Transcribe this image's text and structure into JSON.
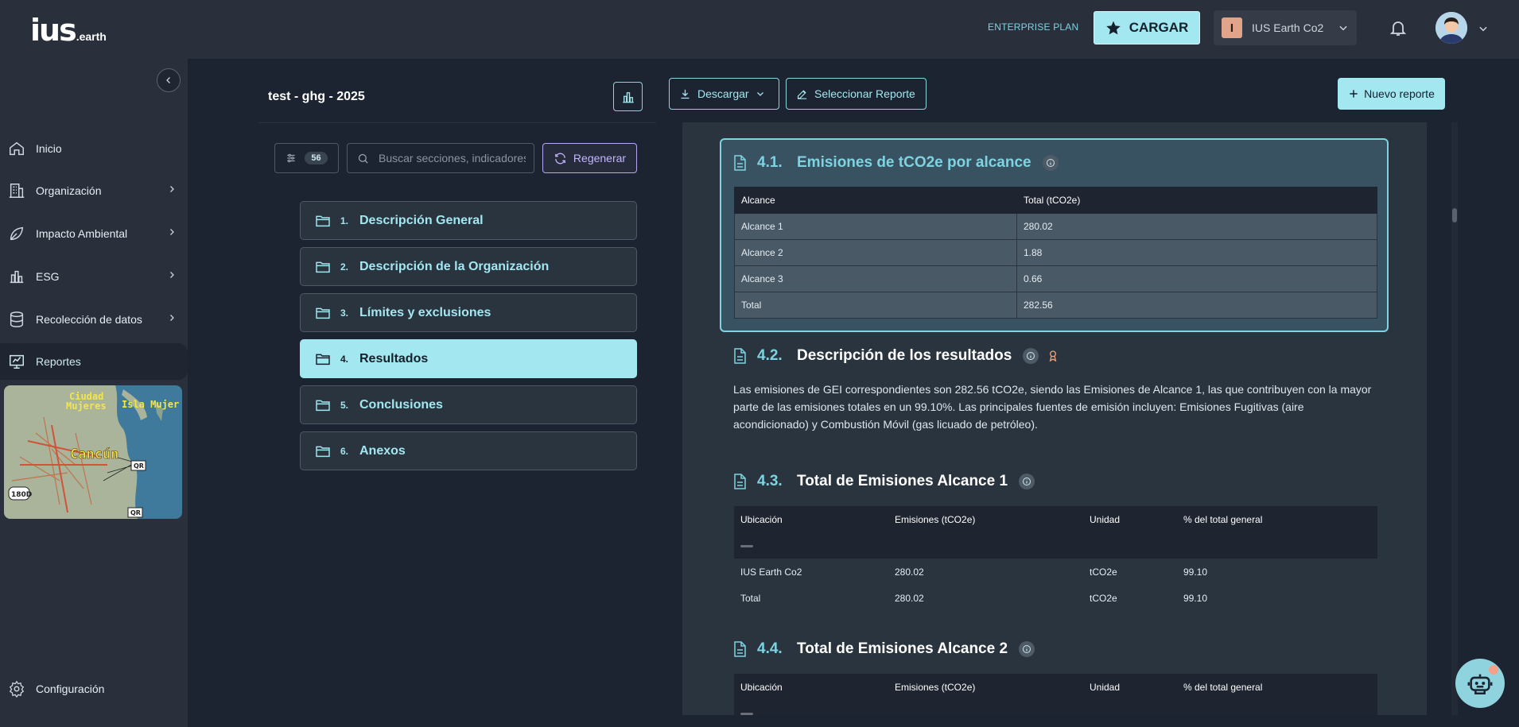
{
  "brand": {
    "logo_main": "ius",
    "logo_sub": ".earth"
  },
  "header": {
    "plan": "ENTERPRISE PLAN",
    "cargar_label": "CARGAR",
    "org_initial": "I",
    "org_name": "IUS Earth Co2"
  },
  "sidebar": {
    "items": [
      {
        "label": "Inicio",
        "icon": "home-icon"
      },
      {
        "label": "Organización",
        "icon": "building-icon"
      },
      {
        "label": "Impacto Ambiental",
        "icon": "leaf-icon"
      },
      {
        "label": "ESG",
        "icon": "bar-chart-icon"
      },
      {
        "label": "Recolección de datos",
        "icon": "database-icon"
      },
      {
        "label": "Reportes",
        "icon": "report-icon"
      },
      {
        "label": "Configuración",
        "icon": "gear-icon"
      }
    ],
    "map": {
      "city": "Cancún",
      "label_ciudad": "Ciudad",
      "label_mujeres": "Mujeres",
      "label_isla": "Isla Mujer",
      "shield_180d": "180D",
      "shield_qr": "QR"
    }
  },
  "toolbar": {
    "report_title": "test - ghg - 2025",
    "descargar": "Descargar",
    "seleccionar": "Seleccionar Reporte",
    "nuevo": "Nuevo reporte",
    "filter_count": "56",
    "search_placeholder": "Buscar secciones, indicadores",
    "regenerar": "Regenerar"
  },
  "sections": [
    {
      "num": "1.",
      "label": "Descripción General"
    },
    {
      "num": "2.",
      "label": "Descripción de la Organización"
    },
    {
      "num": "3.",
      "label": "Límites y exclusiones"
    },
    {
      "num": "4.",
      "label": "Resultados"
    },
    {
      "num": "5.",
      "label": "Conclusiones"
    },
    {
      "num": "6.",
      "label": "Anexos"
    }
  ],
  "report": {
    "s41": {
      "num": "4.1.",
      "title": "Emisiones de tCO2e por alcance",
      "headers": [
        "Alcance",
        "Total (tCO2e)"
      ],
      "rows": [
        [
          "Alcance 1",
          "280.02"
        ],
        [
          "Alcance 2",
          "1.88"
        ],
        [
          "Alcance 3",
          "0.66"
        ],
        [
          "Total",
          "282.56"
        ]
      ]
    },
    "s42": {
      "num": "4.2.",
      "title": "Descripción de los resultados",
      "text": "Las emisiones de GEI correspondientes son 282.56 tCO2e, siendo las Emisiones de Alcance 1, las que contribuyen con la mayor parte de las emisiones totales en un 99.10%. Las principales fuentes de emisión incluyen: Emisiones Fugitivas (aire acondicionado) y Combustión Móvil (gas licuado de petróleo)."
    },
    "s43": {
      "num": "4.3.",
      "title": "Total de Emisiones Alcance 1",
      "headers": [
        "Ubicación",
        "Emisiones (tCO2e)",
        "Unidad",
        "% del total general"
      ],
      "rows": [
        [
          "IUS Earth Co2",
          "280.02",
          "tCO2e",
          "99.10"
        ],
        [
          "Total",
          "280.02",
          "tCO2e",
          "99.10"
        ]
      ]
    },
    "s44": {
      "num": "4.4.",
      "title": "Total de Emisiones Alcance 2",
      "headers": [
        "Ubicación",
        "Emisiones (tCO2e)",
        "Unidad",
        "% del total general"
      ]
    }
  },
  "colors": {
    "accent": "#a3e7f1",
    "sidebar": "#29303c",
    "background": "#1c2431",
    "regen": "#c4b5fd"
  }
}
